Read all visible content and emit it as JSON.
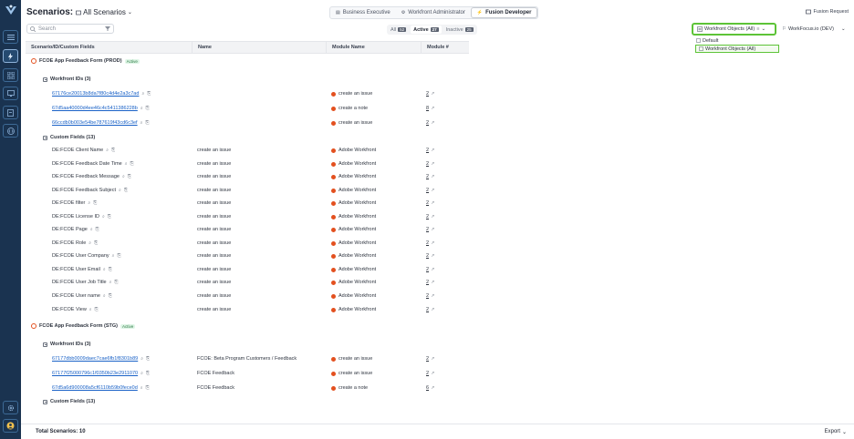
{
  "sidebar": {
    "items": [
      "menu-icon",
      "lightning-icon",
      "dashboard-icon",
      "monitor-icon",
      "document-icon",
      "code-icon"
    ],
    "bottom": [
      "gear-icon",
      "user-icon"
    ]
  },
  "header": {
    "title": "Scenarios:",
    "scope": "All Scenarios",
    "roles": [
      {
        "label": "Business Executive",
        "selected": false
      },
      {
        "label": "Workfront Administrator",
        "selected": false
      },
      {
        "label": "Fusion Developer",
        "selected": true
      }
    ],
    "fusion_request": "Fusion Request"
  },
  "toolbar": {
    "search_placeholder": "Search",
    "filters": [
      {
        "label": "All",
        "count": "52",
        "selected": false
      },
      {
        "label": "Active",
        "count": "27",
        "selected": true
      },
      {
        "label": "Inactive",
        "count": "25",
        "selected": false
      }
    ],
    "wf_objects_label": "Workfront Objects (All)",
    "wf_menu": [
      "Default",
      "Workfront Objects (All)"
    ],
    "workfocus": "WorkFocus.io (DEV)"
  },
  "table": {
    "columns": [
      "Scenario/ID/Custom Fields",
      "Name",
      "Module Name",
      "Module #"
    ],
    "rows": [
      {
        "kind": "scenario",
        "label": "FCOE App Feedback Form (PROD)",
        "status": "Active"
      },
      {
        "kind": "group",
        "label": "Workfront IDs (3)"
      },
      {
        "kind": "id",
        "label": "67176ce20013b8da7f80c4d4e2a3c7ad",
        "name": "",
        "module": "create an issue",
        "num": "2"
      },
      {
        "kind": "id",
        "label": "67d5aa40000d4ee46c4c5411386228b",
        "name": "",
        "module": "create a note",
        "num": "8"
      },
      {
        "kind": "id",
        "label": "66ccdb0b003e54be787619f43cd6c3ef",
        "name": "",
        "module": "create an issue",
        "num": "2"
      },
      {
        "kind": "group",
        "label": "Custom Fields (13)"
      },
      {
        "kind": "field",
        "label": "DE:FCOE Client Name",
        "name": "create an issue",
        "module": "Adobe Workfront",
        "num": "2"
      },
      {
        "kind": "field",
        "label": "DE:FCOE Feedback Date Time",
        "name": "create an issue",
        "module": "Adobe Workfront",
        "num": "2"
      },
      {
        "kind": "field",
        "label": "DE:FCOE Feedback Message",
        "name": "create an issue",
        "module": "Adobe Workfront",
        "num": "2"
      },
      {
        "kind": "field",
        "label": "DE:FCOE Feedback Subject",
        "name": "create an issue",
        "module": "Adobe Workfront",
        "num": "2"
      },
      {
        "kind": "field",
        "label": "DE:FCOE filter",
        "name": "create an issue",
        "module": "Adobe Workfront",
        "num": "2"
      },
      {
        "kind": "field",
        "label": "DE:FCOE License ID",
        "name": "create an issue",
        "module": "Adobe Workfront",
        "num": "2"
      },
      {
        "kind": "field",
        "label": "DE:FCOE Page",
        "name": "create an issue",
        "module": "Adobe Workfront",
        "num": "2"
      },
      {
        "kind": "field",
        "label": "DE:FCOE Role",
        "name": "create an issue",
        "module": "Adobe Workfront",
        "num": "2"
      },
      {
        "kind": "field",
        "label": "DE:FCOE User Company",
        "name": "create an issue",
        "module": "Adobe Workfront",
        "num": "2"
      },
      {
        "kind": "field",
        "label": "DE:FCOE User Email",
        "name": "create an issue",
        "module": "Adobe Workfront",
        "num": "2"
      },
      {
        "kind": "field",
        "label": "DE:FCOE User Job Title",
        "name": "create an issue",
        "module": "Adobe Workfront",
        "num": "2"
      },
      {
        "kind": "field",
        "label": "DE:FCOE User name",
        "name": "create an issue",
        "module": "Adobe Workfront",
        "num": "2"
      },
      {
        "kind": "field",
        "label": "DE:FCOE View",
        "name": "create an issue",
        "module": "Adobe Workfront",
        "num": "2"
      },
      {
        "kind": "scenario",
        "label": "FCOE App Feedback Form (STG)",
        "status": "Active"
      },
      {
        "kind": "group",
        "label": "Workfront IDs (3)"
      },
      {
        "kind": "id",
        "label": "67177dbb0009daec7cae6fb1f8301b89",
        "name": "FCOE: Beta Program Customers / Feedback",
        "module": "create an issue",
        "num": "2"
      },
      {
        "kind": "id",
        "label": "67177f25000796c1f0350b23e2911070",
        "name": "FCOE Feedback",
        "module": "create an issue",
        "num": "2"
      },
      {
        "kind": "id",
        "label": "67d5a6d900008a5cf6110b59b0fece0d",
        "name": "FCOE Feedback",
        "module": "create a note",
        "num": "6"
      },
      {
        "kind": "group",
        "label": "Custom Fields (13)"
      }
    ]
  },
  "footer": {
    "total": "Total Scenarios: 10",
    "export": "Export"
  }
}
